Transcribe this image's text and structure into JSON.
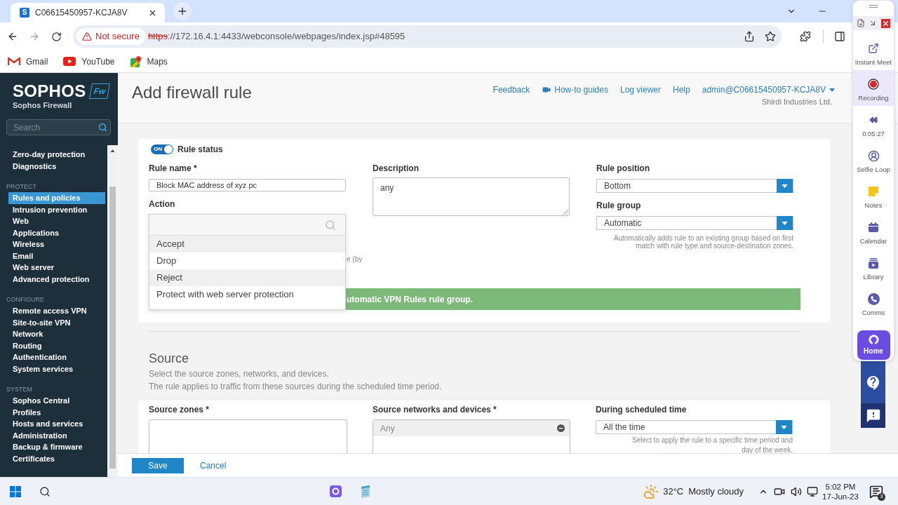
{
  "browser": {
    "tab": {
      "favicon": "S",
      "title": "C06615450957-KCJA8V"
    },
    "address": {
      "security": "Not secure",
      "scheme": "https",
      "url_rest": "://172.16.4.1:4433/webconsole/webpages/index.jsp#48595"
    },
    "bookmarks": [
      {
        "label": "Gmail",
        "kind": "gmail"
      },
      {
        "label": "YouTube",
        "kind": "youtube"
      },
      {
        "label": "Maps",
        "kind": "maps"
      }
    ]
  },
  "sidebar": {
    "brand": "SOPHOS",
    "badge": "Fw",
    "product": "Sophos Firewall",
    "search": {
      "placeholder": "Search"
    },
    "groups": [
      {
        "items": [
          {
            "label": "Zero-day protection",
            "selected": false
          },
          {
            "label": "Diagnostics",
            "selected": false
          }
        ]
      },
      {
        "heading": "PROTECT",
        "items": [
          {
            "label": "Rules and policies",
            "selected": true
          },
          {
            "label": "Intrusion prevention",
            "selected": false
          },
          {
            "label": "Web",
            "selected": false
          },
          {
            "label": "Applications",
            "selected": false
          },
          {
            "label": "Wireless",
            "selected": false
          },
          {
            "label": "Email",
            "selected": false
          },
          {
            "label": "Web server",
            "selected": false
          },
          {
            "label": "Advanced protection",
            "selected": false
          }
        ]
      },
      {
        "heading": "CONFIGURE",
        "items": [
          {
            "label": "Remote access VPN",
            "selected": false
          },
          {
            "label": "Site-to-site VPN",
            "selected": false
          },
          {
            "label": "Network",
            "selected": false
          },
          {
            "label": "Routing",
            "selected": false
          },
          {
            "label": "Authentication",
            "selected": false
          },
          {
            "label": "System services",
            "selected": false
          }
        ]
      },
      {
        "heading": "SYSTEM",
        "items": [
          {
            "label": "Sophos Central",
            "selected": false
          },
          {
            "label": "Profiles",
            "selected": false
          },
          {
            "label": "Hosts and services",
            "selected": false
          },
          {
            "label": "Administration",
            "selected": false
          },
          {
            "label": "Backup & firmware",
            "selected": false
          },
          {
            "label": "Certificates",
            "selected": false
          }
        ]
      }
    ]
  },
  "header": {
    "title": "Add firewall rule",
    "links": [
      {
        "label": "Feedback",
        "kind": "text"
      },
      {
        "label": "How-to guides",
        "kind": "video"
      },
      {
        "label": "Log viewer",
        "kind": "text"
      },
      {
        "label": "Help",
        "kind": "text"
      }
    ],
    "account": "admin@C06615450957-KCJA8V",
    "organization": "Shirdi Industries Ltd."
  },
  "rule": {
    "status": {
      "switch_label": "ON",
      "on": true,
      "label": "Rule status"
    },
    "name": {
      "label": "Rule name *",
      "value": "Block MAC address of xyz pc"
    },
    "action": {
      "label": "Action",
      "expanded": true,
      "options": [
        {
          "label": "Accept",
          "highlighted": true
        },
        {
          "label": "Drop",
          "highlighted": false
        },
        {
          "label": "Reject",
          "highlighted": true
        },
        {
          "label": "Protect with web server protection",
          "highlighted": false
        }
      ]
    },
    "covered_hint": "e (by",
    "banner": "utomatic VPN Rules rule group.",
    "description": {
      "label": "Description",
      "value": "any"
    },
    "position": {
      "label": "Rule position",
      "value": "Bottom"
    },
    "group": {
      "label": "Rule group",
      "value": "Automatic",
      "hint_lines": [
        "Automatically adds rule to an existing group based on first",
        "match with rule type and source-destination zones."
      ]
    }
  },
  "source": {
    "title": "Source",
    "lines": [
      "Select the source zones, networks, and devices.",
      "The rule applies to traffic from these sources during the scheduled time period."
    ],
    "zones": {
      "label": "Source zones *"
    },
    "networks": {
      "label": "Source networks and devices *",
      "items": [
        "Any"
      ]
    },
    "schedule": {
      "label": "During scheduled time",
      "value": "All the time",
      "hint_lines": [
        "Select to apply the rule to a specific time period and",
        "day of the week."
      ]
    }
  },
  "footer": {
    "buttons": [
      {
        "label": "Save",
        "kind": "primary"
      },
      {
        "label": "Cancel",
        "kind": "link"
      }
    ]
  },
  "recorder": {
    "items": [
      {
        "label": "Instant Meet",
        "kind": "meet",
        "selected": false
      },
      {
        "label": "Recording",
        "kind": "record",
        "selected": true
      },
      {
        "label": "0:05:27",
        "kind": "rewind",
        "selected": false
      },
      {
        "label": "Selfie Loop",
        "kind": "selfie",
        "selected": false
      },
      {
        "label": "Notes",
        "kind": "notes",
        "selected": false
      },
      {
        "label": "Calendar",
        "kind": "calendar",
        "selected": false
      },
      {
        "label": "Library",
        "kind": "library",
        "selected": false
      },
      {
        "label": "Comms",
        "kind": "comms",
        "selected": false
      }
    ],
    "home": "Home"
  },
  "taskbar": {
    "weather": {
      "temperature": "32°C",
      "condition": "Mostly cloudy"
    },
    "clock": {
      "time": "5:02 PM",
      "date": "17-Jun-23"
    },
    "notifications": "3"
  }
}
